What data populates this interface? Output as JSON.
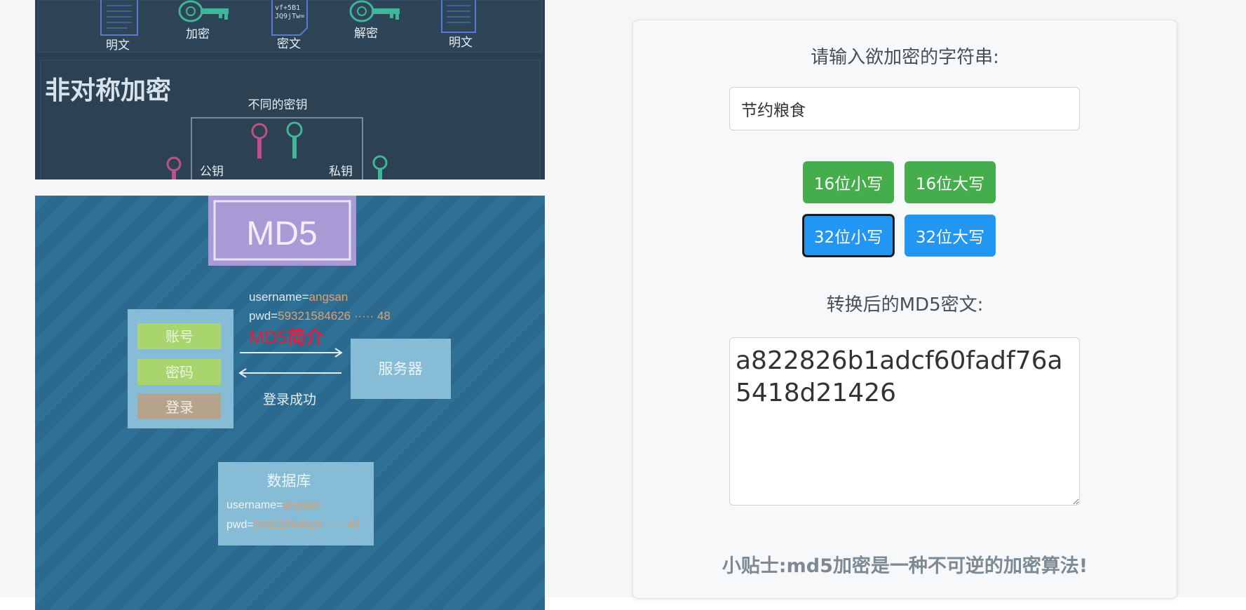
{
  "symmetric_image": {
    "labels": {
      "plaintext_left": "明文",
      "encrypt": "加密",
      "ciphertext": "密文",
      "cipher_sample_line1": "vf+5B1",
      "cipher_sample_line2": "JQ9jTw=",
      "decrypt": "解密",
      "plaintext_right": "明文"
    },
    "asymmetric": {
      "title": "非对称加密",
      "different_keys": "不同的密钥",
      "public_key": "公钥",
      "private_key": "私钥"
    }
  },
  "md5_image": {
    "title": "MD5",
    "request_line1_prefix": "username=",
    "request_line1_value": "angsan",
    "request_line2_prefix": "pwd=",
    "request_line2_value": "59321584626 ····· 48",
    "overlay_md5": "MD5",
    "overlay_intro": "简介",
    "login_form": {
      "account": "账号",
      "password": "密码",
      "login": "登录"
    },
    "server": "服务器",
    "login_success": "登录成功",
    "database": {
      "title": "数据库",
      "line1_prefix": "username=",
      "line1_value": "angsan",
      "line2_prefix": "pwd=",
      "line2_value": "59321584626 ····· 48"
    }
  },
  "form": {
    "input_label": "请输入欲加密的字符串:",
    "input_value": "节约粮食",
    "buttons": {
      "lower16": "16位小写",
      "upper16": "16位大写",
      "lower32": "32位小写",
      "upper32": "32位大写"
    },
    "output_label": "转换后的MD5密文:",
    "output_value": "a822826b1adcf60fadf76a5418d21426",
    "tip": "小贴士:md5加密是一种不可逆的加密算法!"
  },
  "colors": {
    "green_button": "#46ad4c",
    "blue_button": "#2196f3",
    "page_bg": "#f4f6f8",
    "md5_bg": "#2f7196",
    "md5_title_bg": "#a89ad4",
    "intro_red": "#e02040"
  }
}
